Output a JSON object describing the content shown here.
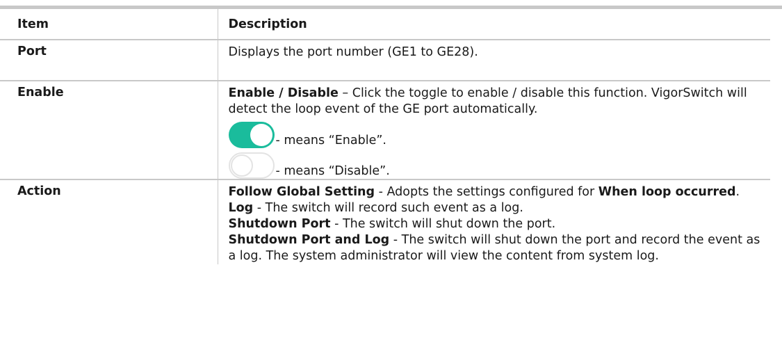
{
  "table": {
    "header": {
      "item": "Item",
      "description": "Description"
    },
    "port": {
      "item": "Port",
      "desc": "Displays the port number (GE1 to GE28)."
    },
    "enable": {
      "item": "Enable",
      "bold_lead": "Enable / Disable",
      "desc_rest": " – Click the toggle to enable / disable this function. VigorSwitch will detect the loop event of the GE port automatically.",
      "toggle_on_text": "- means “Enable”.",
      "toggle_off_text": "- means “Disable”.",
      "toggle_on_color": "#1abc9c"
    },
    "action": {
      "item": "Action",
      "line1_bold": "Follow Global Setting",
      "line1_text": " - Adopts the settings configured for ",
      "line1_bold2": "When loop occurred",
      "line1_end": ".",
      "line2_bold": "Log",
      "line2_text": " - The switch will record such event as a log.",
      "line3_bold": "Shutdown Port",
      "line3_text": " - The switch will shut down the port.",
      "line4_bold": "Shutdown Port and Log",
      "line4_text": " - The switch will shut down the port and record the event as a log. The system administrator will view the content from system log."
    }
  }
}
